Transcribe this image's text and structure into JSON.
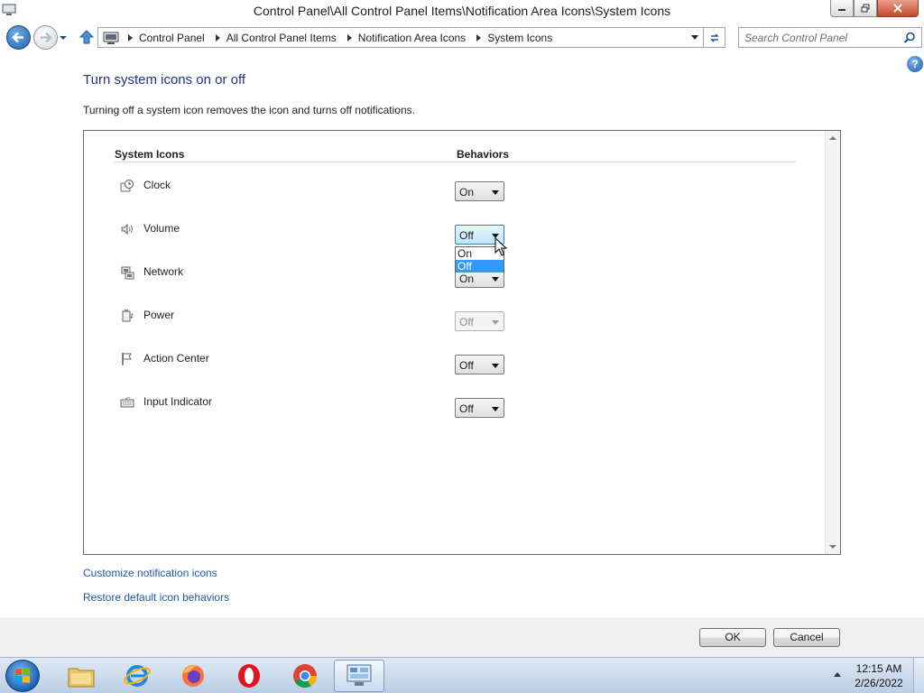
{
  "window": {
    "title": "Control Panel\\All Control Panel Items\\Notification Area Icons\\System Icons"
  },
  "address_bar": {
    "breadcrumbs": [
      "Control Panel",
      "All Control Panel Items",
      "Notification Area Icons",
      "System Icons"
    ]
  },
  "search": {
    "placeholder": "Search Control Panel"
  },
  "content": {
    "title": "Turn system icons on or off",
    "description": "Turning off a system icon removes the icon and turns off notifications.",
    "col_icons": "System Icons",
    "col_behaviors": "Behaviors",
    "rows": [
      {
        "label": "Clock",
        "icon": "clock-icon",
        "value": "On",
        "enabled": true
      },
      {
        "label": "Volume",
        "icon": "volume-icon",
        "value": "Off",
        "enabled": true,
        "open": true
      },
      {
        "label": "Network",
        "icon": "network-icon",
        "value": "On",
        "enabled": true
      },
      {
        "label": "Power",
        "icon": "power-icon",
        "value": "Off",
        "enabled": false
      },
      {
        "label": "Action Center",
        "icon": "flag-icon",
        "value": "Off",
        "enabled": true
      },
      {
        "label": "Input Indicator",
        "icon": "keyboard-icon",
        "value": "Off",
        "enabled": true
      }
    ],
    "dropdown_options": [
      "On",
      "Off"
    ],
    "dropdown_selected": "Off"
  },
  "links": {
    "customize": "Customize notification icons",
    "restore": "Restore default icon behaviors"
  },
  "footer": {
    "ok_label": "OK",
    "cancel_label": "Cancel"
  },
  "taskbar": {
    "items": [
      "file-explorer-icon",
      "internet-explorer-icon",
      "firefox-icon",
      "opera-icon",
      "chrome-icon",
      "control-panel-icon"
    ],
    "time": "12:15 AM",
    "date": "2/26/2022"
  },
  "colors": {
    "title_blue": "#1e3287",
    "link_blue": "#1e5aa5",
    "selection": "#3399ff"
  }
}
